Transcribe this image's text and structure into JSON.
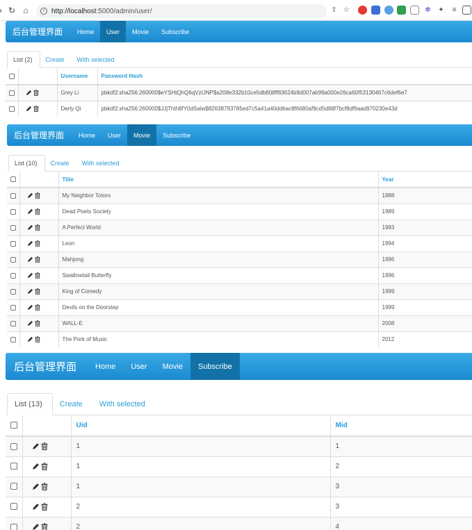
{
  "browser": {
    "back_icon": "back-arrow-icon",
    "url_host": "http://localhost",
    "url_path": ":5000/admin/user/"
  },
  "sections": [
    {
      "brand": "后台管理界面",
      "nav": [
        "Home",
        "User",
        "Movie",
        "Subscribe"
      ],
      "active_nav": "User",
      "tabs": [
        "List (2)",
        "Create",
        "With selected"
      ],
      "columns": [
        "Username",
        "Password Hash"
      ],
      "rows": [
        [
          "Grey Li",
          "pbkdf2:sha256:260000$eYSHtQhQ6qVzIJNP$a208e332b10ce5db808ff83624b9d007ab99a000e26ca60f53130467c6def6e7"
        ],
        [
          "Derly Qi",
          "pbkdf2:sha256:260000$JJjThth8fY0dSalw$82638793785ed7c5a41a40dd6ac8f6680af9cd5d88f7bcf8df9aad970230e43d"
        ]
      ]
    },
    {
      "brand": "后台管理界面",
      "nav": [
        "Home",
        "User",
        "Movie",
        "Subscribe"
      ],
      "active_nav": "Movie",
      "tabs": [
        "List (10)",
        "Create",
        "With selected"
      ],
      "columns": [
        "Title",
        "Year"
      ],
      "rows": [
        [
          "My Neighbor Totoro",
          "1988"
        ],
        [
          "Dead Poets Society",
          "1989"
        ],
        [
          "A Perfect World",
          "1993"
        ],
        [
          "Leon",
          "1994"
        ],
        [
          "Mahjong",
          "1996"
        ],
        [
          "Swallowtail Butterfly",
          "1996"
        ],
        [
          "King of Comedy",
          "1999"
        ],
        [
          "Devils on the Doorstep",
          "1999"
        ],
        [
          "WALL-E",
          "2008"
        ],
        [
          "The Pork of Music",
          "2012"
        ]
      ]
    },
    {
      "brand": "后台管理界面",
      "nav": [
        "Home",
        "User",
        "Movie",
        "Subscribe"
      ],
      "active_nav": "Subscribe",
      "tabs": [
        "List (13)",
        "Create",
        "With selected"
      ],
      "columns": [
        "Uid",
        "Mid"
      ],
      "rows": [
        [
          "1",
          "1"
        ],
        [
          "1",
          "2"
        ],
        [
          "1",
          "3"
        ],
        [
          "2",
          "3"
        ],
        [
          "2",
          "4"
        ]
      ]
    }
  ],
  "colors": {
    "navbar": "#2a9fd6",
    "active_nav": "#1272a8",
    "link": "#2a9fd6"
  }
}
